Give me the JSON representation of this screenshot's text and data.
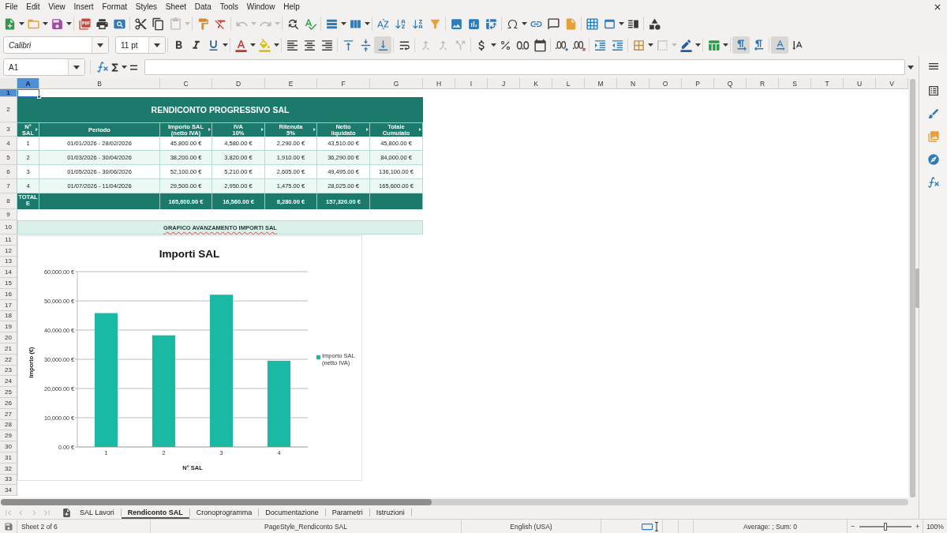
{
  "menu_bar": {
    "items": [
      "File",
      "Edit",
      "View",
      "Insert",
      "Format",
      "Styles",
      "Sheet",
      "Data",
      "Tools",
      "Window",
      "Help"
    ]
  },
  "standard_toolbar": {
    "buttons": [
      {
        "disabled": false
      },
      {
        "disabled": false
      },
      {
        "disabled": false
      },
      {
        "disabled": false
      },
      {
        "disabled": false
      },
      {
        "disabled": false
      },
      {
        "disabled": false
      },
      {
        "disabled": false
      },
      {
        "disabled": true
      },
      {
        "disabled": false
      },
      {
        "disabled": false
      },
      {
        "disabled": true
      },
      {
        "disabled": true
      },
      {
        "disabled": false
      },
      {
        "disabled": false
      },
      {
        "disabled": false
      },
      {
        "disabled": false
      },
      {
        "disabled": false
      },
      {
        "disabled": false
      },
      {
        "disabled": false
      },
      {
        "disabled": false
      },
      {
        "disabled": false
      },
      {
        "disabled": false
      },
      {
        "disabled": false
      },
      {
        "disabled": false
      },
      {
        "disabled": false
      },
      {
        "disabled": false
      },
      {
        "disabled": false
      },
      {
        "disabled": false
      },
      {
        "disabled": false
      },
      {
        "disabled": false
      },
      {
        "disabled": false
      }
    ]
  },
  "formatting_toolbar": {
    "font_name": "Calibri",
    "font_size": "11 pt",
    "buttons": [
      {
        "pressed": false,
        "disabled": false
      },
      {
        "pressed": false,
        "disabled": false
      },
      {
        "pressed": false,
        "disabled": false
      },
      {
        "pressed": false,
        "disabled": false
      },
      {
        "pressed": false,
        "disabled": false
      },
      {
        "pressed": false,
        "disabled": false
      },
      {
        "pressed": false,
        "disabled": false
      },
      {
        "pressed": false,
        "disabled": false
      },
      {
        "pressed": false,
        "disabled": false
      },
      {
        "pressed": false,
        "disabled": false
      },
      {
        "pressed": true,
        "disabled": false
      },
      {
        "pressed": false,
        "disabled": false
      },
      {
        "pressed": false,
        "disabled": true
      },
      {
        "pressed": false,
        "disabled": true
      },
      {
        "pressed": false,
        "disabled": true
      },
      {
        "pressed": false,
        "disabled": false
      },
      {
        "pressed": false,
        "disabled": false
      },
      {
        "pressed": false,
        "disabled": false
      },
      {
        "pressed": false,
        "disabled": false
      },
      {
        "pressed": false,
        "disabled": false
      },
      {
        "pressed": false,
        "disabled": false
      },
      {
        "pressed": false,
        "disabled": false
      },
      {
        "pressed": false,
        "disabled": false
      },
      {
        "pressed": false,
        "disabled": false
      },
      {
        "pressed": false,
        "disabled": true
      },
      {
        "pressed": false,
        "disabled": false
      },
      {
        "pressed": false,
        "disabled": false
      },
      {
        "pressed": true,
        "disabled": false
      },
      {
        "pressed": false,
        "disabled": false
      },
      {
        "pressed": true,
        "disabled": false
      },
      {
        "pressed": false,
        "disabled": false
      }
    ]
  },
  "formula_bar": {
    "name_box": "A1"
  },
  "sheet": {
    "columns": [
      {
        "label": "A",
        "selected": true
      },
      {
        "label": "B",
        "selected": false
      },
      {
        "label": "C",
        "selected": false
      },
      {
        "label": "D",
        "selected": false
      },
      {
        "label": "E",
        "selected": false
      },
      {
        "label": "F",
        "selected": false
      },
      {
        "label": "G",
        "selected": false
      },
      {
        "label": "H",
        "selected": false
      },
      {
        "label": "I",
        "selected": false
      },
      {
        "label": "J",
        "selected": false
      },
      {
        "label": "K",
        "selected": false
      },
      {
        "label": "L",
        "selected": false
      },
      {
        "label": "M",
        "selected": false
      },
      {
        "label": "N",
        "selected": false
      },
      {
        "label": "O",
        "selected": false
      },
      {
        "label": "P",
        "selected": false
      },
      {
        "label": "Q",
        "selected": false
      },
      {
        "label": "R",
        "selected": false
      },
      {
        "label": "S",
        "selected": false
      },
      {
        "label": "T",
        "selected": false
      },
      {
        "label": "U",
        "selected": false
      },
      {
        "label": "V",
        "selected": false
      }
    ],
    "rows": [
      {
        "label": "1",
        "selected": true
      },
      {
        "label": "2",
        "selected": false
      },
      {
        "label": "3",
        "selected": false
      },
      {
        "label": "4",
        "selected": false
      },
      {
        "label": "5",
        "selected": false
      },
      {
        "label": "6",
        "selected": false
      },
      {
        "label": "7",
        "selected": false
      },
      {
        "label": "8",
        "selected": false
      },
      {
        "label": "9",
        "selected": false
      },
      {
        "label": "10",
        "selected": false
      },
      {
        "label": "11",
        "selected": false
      },
      {
        "label": "12",
        "selected": false
      },
      {
        "label": "13",
        "selected": false
      },
      {
        "label": "14",
        "selected": false
      },
      {
        "label": "15",
        "selected": false
      },
      {
        "label": "16",
        "selected": false
      },
      {
        "label": "17",
        "selected": false
      },
      {
        "label": "18",
        "selected": false
      },
      {
        "label": "19",
        "selected": false
      },
      {
        "label": "20",
        "selected": false
      },
      {
        "label": "21",
        "selected": false
      },
      {
        "label": "22",
        "selected": false
      },
      {
        "label": "23",
        "selected": false
      },
      {
        "label": "24",
        "selected": false
      },
      {
        "label": "25",
        "selected": false
      },
      {
        "label": "26",
        "selected": false
      },
      {
        "label": "27",
        "selected": false
      },
      {
        "label": "28",
        "selected": false
      },
      {
        "label": "29",
        "selected": false
      },
      {
        "label": "30",
        "selected": false
      },
      {
        "label": "31",
        "selected": false
      },
      {
        "label": "32",
        "selected": false
      },
      {
        "label": "33",
        "selected": false
      },
      {
        "label": "34",
        "selected": false
      }
    ],
    "report": {
      "title": "RENDICONTO PROGRESSIVO SAL",
      "headers": [
        {
          "text": "N°\nSAL",
          "clipped": true
        },
        {
          "text": "Periodo",
          "clipped": false
        },
        {
          "text": "Importo SAL\n(netto IVA)",
          "clipped": true
        },
        {
          "text": "IVA\n10%",
          "clipped": true
        },
        {
          "text": "Ritenuta\n5%",
          "clipped": true
        },
        {
          "text": "Netto\nliquidato",
          "clipped": true
        },
        {
          "text": "Totale\nCumulato",
          "clipped": true
        }
      ],
      "rows": [
        [
          "1",
          "01/01/2026 - 28/02/2026",
          "45,800.00 €",
          "4,580.00 €",
          "2,290.00 €",
          "43,510.00 €",
          "45,800.00 €"
        ],
        [
          "2",
          "01/03/2026 - 30/04/2026",
          "38,200.00 €",
          "3,820.00 €",
          "1,910.00 €",
          "36,290.00 €",
          "84,000.00 €"
        ],
        [
          "3",
          "01/05/2026 - 30/06/2026",
          "52,100.00 €",
          "5,210.00 €",
          "2,605.00 €",
          "49,495.00 €",
          "136,100.00 €"
        ],
        [
          "4",
          "01/07/2026 - 11/04/2026",
          "29,500.00 €",
          "2,950.00 €",
          "1,475.00 €",
          "28,025.00 €",
          "165,600.00 €"
        ]
      ],
      "totals": {
        "label": "TOTALE",
        "amount": "165,600.00 €",
        "vat": "16,560.00 €",
        "withholding": "8,280.00 €",
        "net": "157,320.00 €"
      },
      "chart_heading": "GRAFICO AVANZAMENTO IMPORTI SAL",
      "chart": {
        "chart_data": {
          "type": "bar",
          "title": "Importi SAL",
          "xlabel": "N° SAL",
          "ylabel": "Importo (€)",
          "categories": [
            "1",
            "2",
            "3",
            "4"
          ],
          "series": [
            {
              "name": "Importo SAL (netto IVA)",
              "color": "#1ab9a4",
              "values": [
                45800,
                38200,
                52100,
                29500
              ]
            }
          ],
          "ylim": [
            0,
            60000
          ],
          "yticks": [
            {
              "value": 0,
              "label": "0.00 €"
            },
            {
              "value": 10000,
              "label": "10,000.00 €"
            },
            {
              "value": 20000,
              "label": "20,000.00 €"
            },
            {
              "value": 30000,
              "label": "30,000.00 €"
            },
            {
              "value": 40000,
              "label": "40,000.00 €"
            },
            {
              "value": 50000,
              "label": "50,000.00 €"
            },
            {
              "value": 60000,
              "label": "60,000.00 €"
            }
          ],
          "grid": true
        }
      }
    }
  },
  "sheet_navigation": [
    {
      "disabled": true
    },
    {
      "disabled": true
    },
    {
      "disabled": true
    },
    {
      "disabled": true
    }
  ],
  "sheet_tabs": [
    {
      "label": "SAL Lavori",
      "selected": false
    },
    {
      "label": "Rendiconto SAL",
      "selected": true
    },
    {
      "label": "Cronoprogramma",
      "selected": false
    },
    {
      "label": "Documentazione",
      "selected": false
    },
    {
      "label": "Parametri",
      "selected": false
    },
    {
      "label": "Istruzioni",
      "selected": false
    }
  ],
  "status_bar": {
    "sheet_position": "Sheet 2 of 6",
    "page_style": "PageStyle_Rendiconto SAL",
    "language": "English (USA)",
    "selection_summary": "Average: ; Sum: 0",
    "zoom_slider": {
      "level": 0.5
    },
    "zoom_percent": "100%"
  }
}
